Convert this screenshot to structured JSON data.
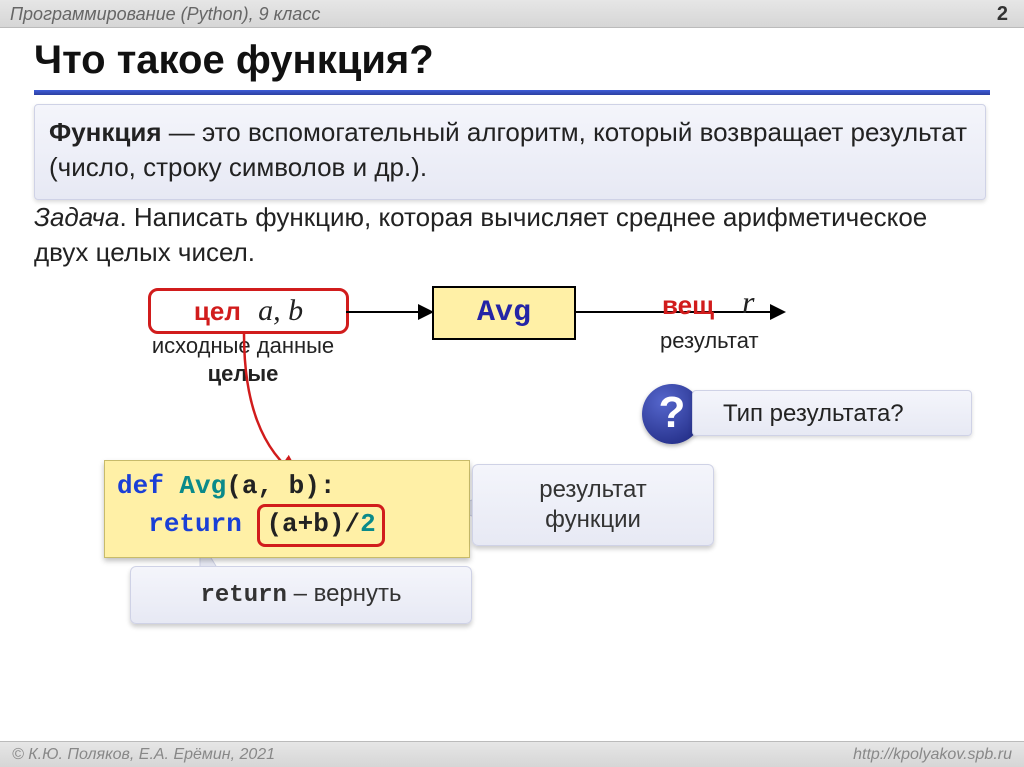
{
  "header": {
    "course": "Программирование (Python), 9 класс",
    "pageNumber": "2"
  },
  "title": "Что такое функция?",
  "definition": {
    "term": "Функция",
    "rest": " — это вспомогательный алгоритм, который возвращает результат (число, строку символов и др.)."
  },
  "task": {
    "label": "Задача",
    "rest": ". Написать функцию, которая вычисляет среднее арифметическое двух целых чисел."
  },
  "diagram": {
    "inputTypeLabel": "цел",
    "inputVars": "a, b",
    "inputCaptionLine1": "исходные данные",
    "inputCaptionLine2": "целые",
    "fnName": "Avg",
    "outputTypeLabel": "вещ",
    "outputVar": "r",
    "outputCaption": "результат",
    "questionMark": "?",
    "questionText": "Тип результата?"
  },
  "code": {
    "kw_def": "def",
    "fn": "Avg",
    "params": "(a, b):",
    "kw_return": "return",
    "expr_open": "(a+b)/",
    "expr_num": "2"
  },
  "callouts": {
    "resultLine1": "результат",
    "resultLine2": "функции",
    "returnMono": "return",
    "returnDash": " – вернуть"
  },
  "footer": {
    "left": "© К.Ю. Поляков, Е.А. Ерёмин, 2021",
    "right": "http://kpolyakov.spb.ru"
  }
}
